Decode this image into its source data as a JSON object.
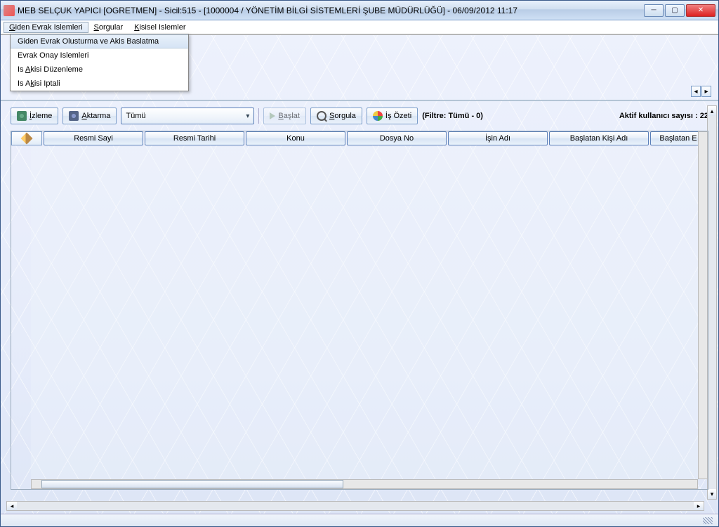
{
  "title": "MEB   SELÇUK YAPICI  [OGRETMEN] - Sicil:515 - [1000004 / YÖNETİM BİLGİ SİSTEMLERİ ŞUBE MÜDÜRLÜĞÜ] - 06/09/2012 11:17",
  "menubar": {
    "giden": "Giden Evrak Islemleri",
    "sorgular": "Sorgular",
    "kisisel": "Kisisel Islemler"
  },
  "dropdown": {
    "item1": "Giden Evrak Olusturma ve Akis Baslatma",
    "item2": "Evrak Onay Islemleri",
    "item3": "Is Akisi Düzenleme",
    "item4": "Is Akisi Iptali"
  },
  "toolbar": {
    "izleme": "İzleme",
    "aktarma": "Aktarma",
    "combo_value": "Tümü",
    "baslat": "Başlat",
    "sorgula": "Sorgula",
    "isozeti": "İş Özeti",
    "filter": "(Filtre: Tümü - 0)",
    "active_users": "Aktif kullanıcı sayısı : 22"
  },
  "columns": {
    "c1": "Resmi Sayi",
    "c2": "Resmi Tarihi",
    "c3": "Konu",
    "c4": "Dosya No",
    "c5": "İşin Adı",
    "c6": "Başlatan Kişi Adı",
    "c7": "Başlatan E"
  }
}
